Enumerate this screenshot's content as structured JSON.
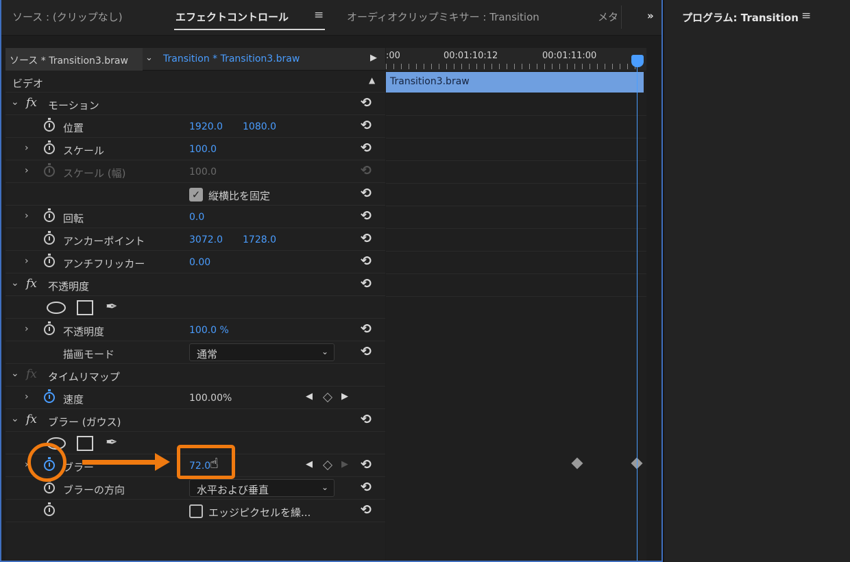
{
  "tabs": {
    "source": "ソース : (クリップなし)",
    "effect_controls": "エフェクトコントロール",
    "menu_icon": "≡",
    "audio_mixer": "オーディオクリップミキサー : Transition",
    "meta": "メタ",
    "overflow": "»"
  },
  "program": {
    "title": "プログラム: Transition",
    "menu_icon": "≡"
  },
  "source_bar": {
    "master": "ソース * Transition3.braw",
    "clip": "Transition * Transition3.braw"
  },
  "video_header": "ビデオ",
  "motion": {
    "title": "モーション",
    "position": {
      "label": "位置",
      "x": "1920.0",
      "y": "1080.0"
    },
    "scale": {
      "label": "スケール",
      "value": "100.0"
    },
    "scale_width": {
      "label": "スケール (幅)",
      "value": "100.0"
    },
    "uniform_scale": {
      "label": "縦横比を固定",
      "checked": true
    },
    "rotation": {
      "label": "回転",
      "value": "0.0"
    },
    "anchor": {
      "label": "アンカーポイント",
      "x": "3072.0",
      "y": "1728.0"
    },
    "antiflicker": {
      "label": "アンチフリッカー",
      "value": "0.00"
    }
  },
  "opacity": {
    "title": "不透明度",
    "opacity": {
      "label": "不透明度",
      "value": "100.0 %"
    },
    "blend_mode": {
      "label": "描画モード",
      "value": "通常"
    }
  },
  "time_remap": {
    "title": "タイムリマップ",
    "speed": {
      "label": "速度",
      "value": "100.00%"
    }
  },
  "gaussian_blur": {
    "title": "ブラー (ガウス)",
    "blurriness": {
      "label": "ブラー",
      "value": "72.0"
    },
    "dimension": {
      "label": "ブラーの方向",
      "value": "水平および垂直"
    },
    "repeat_edge": {
      "label": "エッジピクセルを繰...",
      "checked": false
    }
  },
  "timeline": {
    "tc_start": ":00",
    "tc_1": "00:01:10:12",
    "tc_2": "00:01:11:00",
    "clip_name": "Transition3.braw"
  },
  "annotation_color": "#f07a10",
  "accent_color": "#4a9dff"
}
